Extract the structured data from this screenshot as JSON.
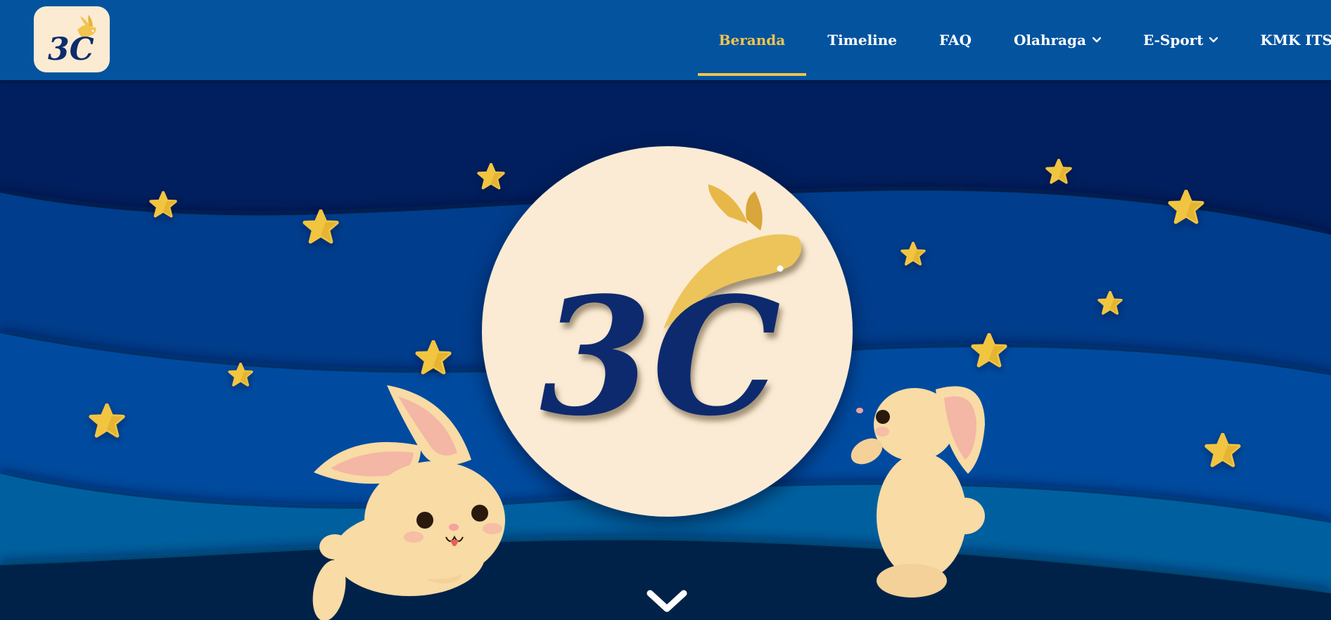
{
  "header": {
    "logo": {
      "text": "3C",
      "icon": "rabbit-logo"
    },
    "nav": [
      {
        "label": "Beranda",
        "active": true,
        "dropdown": false
      },
      {
        "label": "Timeline",
        "active": false,
        "dropdown": false
      },
      {
        "label": "FAQ",
        "active": false,
        "dropdown": false
      },
      {
        "label": "Olahraga",
        "active": false,
        "dropdown": true
      },
      {
        "label": "E-Sport",
        "active": false,
        "dropdown": true
      },
      {
        "label": "KMK ITS",
        "active": false,
        "dropdown": false
      }
    ]
  },
  "hero": {
    "emblem_text": "3C",
    "scroll_icon": "chevron-down-icon"
  },
  "colors": {
    "header_bg": "#03539f",
    "accent": "#f1c44e",
    "navy": "#0a2c6e",
    "cream": "#fbebd4"
  }
}
